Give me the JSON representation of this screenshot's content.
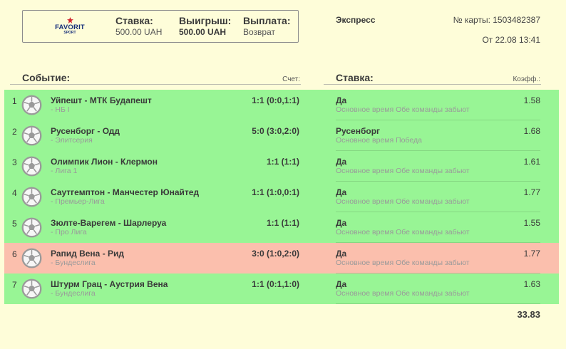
{
  "header": {
    "logo_text": "FAVORIT",
    "logo_subtext": "SPORT",
    "stake_label": "Ставка:",
    "stake_value": "500.00 UAH",
    "win_label": "Выигрыш:",
    "win_value": "500.00 UAH",
    "payout_label": "Выплата:",
    "payout_value": "Возврат",
    "bet_type": "Экспресс",
    "card_number": "№ карты: 1503482387",
    "date": "От 22.08 13:41"
  },
  "columns": {
    "event": "Событие:",
    "score": "Счет:",
    "stake": "Ставка:",
    "coef": "Коэфф.:"
  },
  "colors": {
    "won": "#98f595",
    "lost": "#fbbfad",
    "background": "#fefdd9",
    "brand": "#17307a",
    "brand_accent": "#d0262e"
  },
  "events": [
    {
      "num": "1",
      "teams": "Уйпешт - МТК Будапешт",
      "league": "- НБ I",
      "score": "1:1 (0:0,1:1)",
      "pick": "Да",
      "market": "Основное время Обе команды забьют",
      "coef": "1.58",
      "status": "won",
      "icon": "soccer-ball-icon"
    },
    {
      "num": "2",
      "teams": "Русенборг - Одд",
      "league": "- Элитсерия",
      "score": "5:0 (3:0,2:0)",
      "pick": "Русенборг",
      "market": "Основное время Победа",
      "coef": "1.68",
      "status": "won",
      "icon": "soccer-ball-icon"
    },
    {
      "num": "3",
      "teams": "Олимпик Лион - Клермон",
      "league": "- Лига 1",
      "score": "1:1 (1:1)",
      "pick": "Да",
      "market": "Основное время Обе команды забьют",
      "coef": "1.61",
      "status": "won",
      "icon": "soccer-ball-icon"
    },
    {
      "num": "4",
      "teams": "Саутгемптон - Манчестер Юнайтед",
      "league": "- Премьер-Лига",
      "score": "1:1 (1:0,0:1)",
      "pick": "Да",
      "market": "Основное время Обе команды забьют",
      "coef": "1.77",
      "status": "won",
      "icon": "soccer-ball-icon"
    },
    {
      "num": "5",
      "teams": "Зюлте-Варегем - Шарлеруа",
      "league": "- Про Лига",
      "score": "1:1 (1:1)",
      "pick": "Да",
      "market": "Основное время Обе команды забьют",
      "coef": "1.55",
      "status": "won",
      "icon": "soccer-ball-icon"
    },
    {
      "num": "6",
      "teams": "Рапид Вена - Рид",
      "league": "- Бундеслига",
      "score": "3:0 (1:0,2:0)",
      "pick": "Да",
      "market": "Основное время Обе команды забьют",
      "coef": "1.77",
      "status": "lost",
      "icon": "soccer-ball-icon"
    },
    {
      "num": "7",
      "teams": "Штурм Грац - Аустрия Вена",
      "league": "- Бундеслига",
      "score": "1:1 (0:1,1:0)",
      "pick": "Да",
      "market": "Основное время Обе команды забьют",
      "coef": "1.63",
      "status": "won",
      "icon": "soccer-ball-icon"
    }
  ],
  "total_coef": "33.83"
}
